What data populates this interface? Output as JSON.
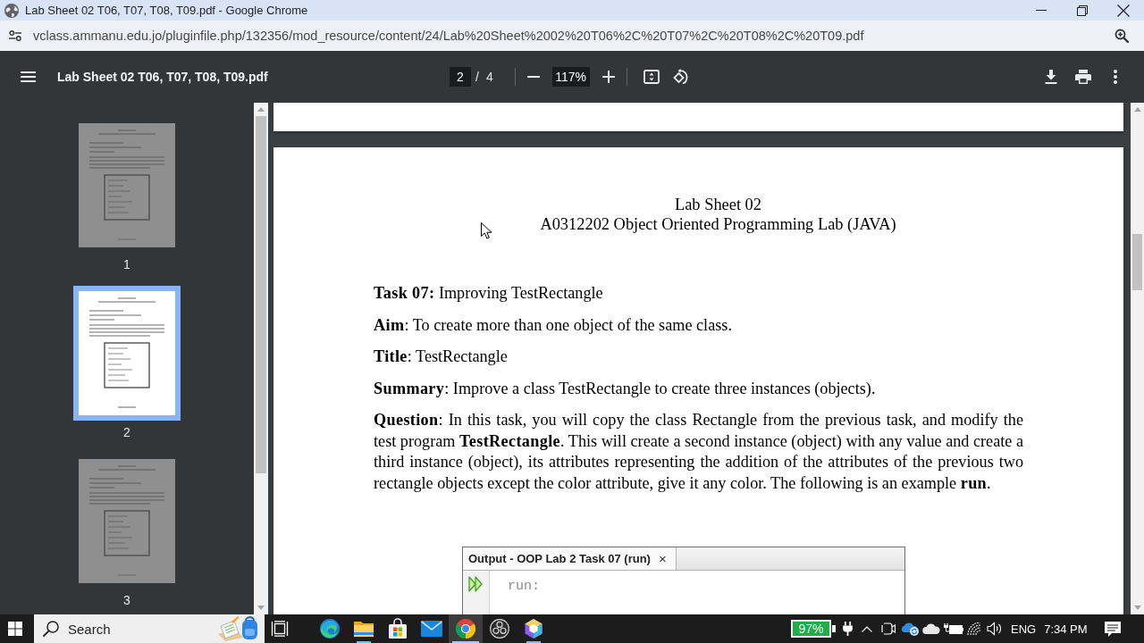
{
  "window": {
    "title": "Lab Sheet 02 T06, T07, T08, T09.pdf - Google Chrome"
  },
  "address_bar": {
    "url": "vclass.ammanu.edu.jo/pluginfile.php/132356/mod_resource/content/24/Lab%20Sheet%2002%20T06%2C%20T07%2C%20T08%2C%20T09.pdf"
  },
  "pdf_toolbar": {
    "file_name": "Lab Sheet 02 T06, T07, T08, T09.pdf",
    "current_page": "2",
    "page_separator": "/",
    "page_count": "4",
    "zoom": "117%"
  },
  "thumbnails": [
    {
      "label": "1",
      "selected": false
    },
    {
      "label": "2",
      "selected": true
    },
    {
      "label": "3",
      "selected": false
    }
  ],
  "document": {
    "heading": "Lab Sheet 02",
    "subheading": "A0312202 Object Oriented Programming Lab (JAVA)",
    "paragraphs": [
      "**Task 07:** Improving TestRectangle",
      "**Aim**: To create more than one object of the same class.",
      "**Title**: TestRectangle",
      "**Summary**: Improve a class TestRectangle to create three instances (objects).",
      "**Question**: In this task, you will copy the class Rectangle from the previous task, and modify the test program **TestRectangle**. This will create a second instance (object) with any value and create a third instance (object), its attributes representing the addition of the attributes of the previous two rectangle objects except the color attribute, give it any color. The following is an example **run**."
    ],
    "output_window": {
      "tab_title": "Output - OOP Lab 2 Task 07 (run)",
      "close_symbol": "×",
      "lines": [
        "run:"
      ]
    }
  },
  "taskbar": {
    "search": {
      "placeholder": "Search"
    },
    "apps": [
      {
        "kind": "swirl",
        "running": false,
        "selected": false
      },
      {
        "kind": "folder",
        "running": true,
        "selected": false
      },
      {
        "kind": "bag",
        "running": false,
        "selected": false
      },
      {
        "kind": "mail",
        "running": false,
        "selected": false
      },
      {
        "kind": "ring",
        "running": true,
        "selected": true
      },
      {
        "kind": "aperture",
        "running": false,
        "selected": false
      },
      {
        "kind": "hexagon",
        "running": true,
        "selected": false
      }
    ],
    "battery": "97%",
    "language": "ENG",
    "time": "7:34 PM"
  }
}
